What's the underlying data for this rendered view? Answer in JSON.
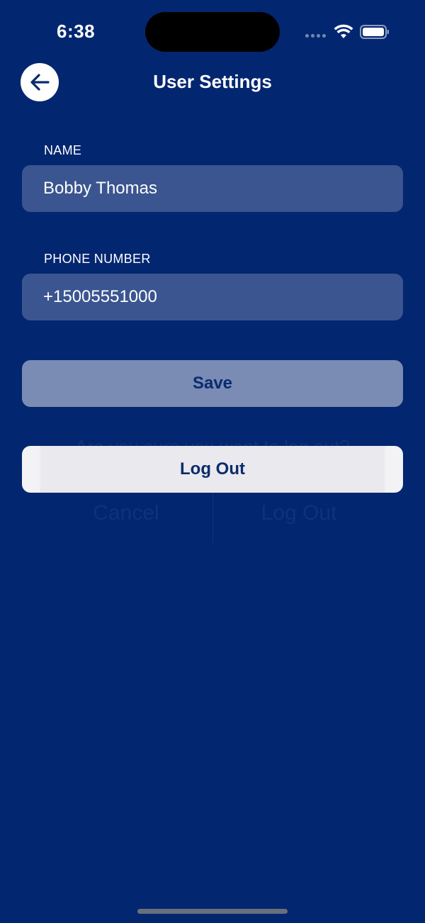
{
  "status_bar": {
    "time": "6:38"
  },
  "header": {
    "title": "User Settings",
    "back_icon": "arrow-left-icon"
  },
  "form": {
    "name": {
      "label": "NAME",
      "value": "Bobby Thomas"
    },
    "phone": {
      "label": "PHONE NUMBER",
      "value": "+15005551000"
    }
  },
  "actions": {
    "save_label": "Save",
    "logout_label": "Log Out"
  },
  "background_dialog": {
    "message": "Are you sure you want to log out?",
    "cancel_label": "Cancel",
    "confirm_label": "Log Out"
  },
  "colors": {
    "background": "#032670",
    "accent_text": "#0a2b6e",
    "save_button": "#7a8cb4",
    "logout_button": "#e9e9ee"
  }
}
